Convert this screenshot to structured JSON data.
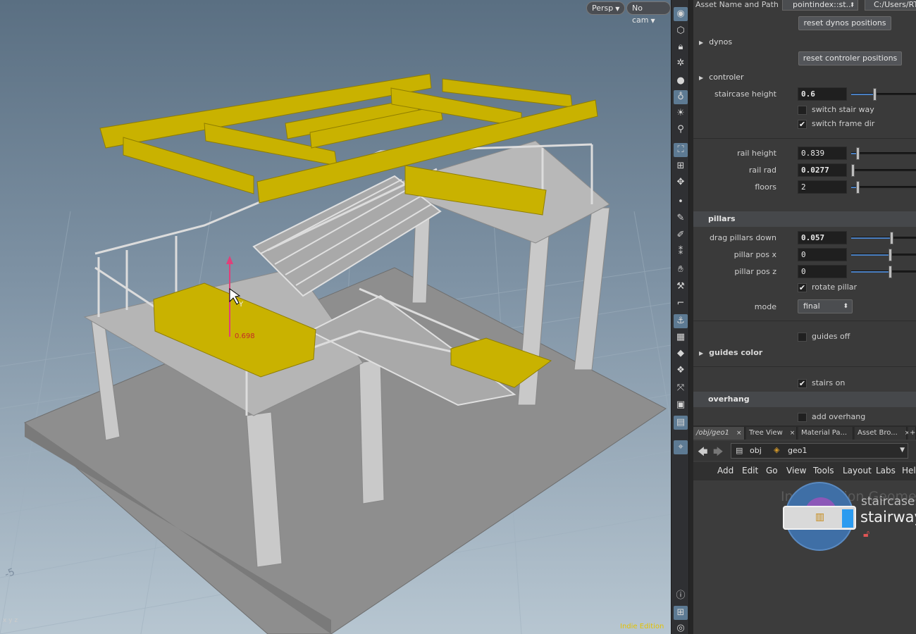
{
  "viewport": {
    "persp_label": "Persp",
    "cam_label": "No cam",
    "edition_label": "Indie Edition",
    "handle_value": "0.698",
    "handle_axis": "Y",
    "grid_number": "-5",
    "axis_label": "x y z"
  },
  "toolstrip": {
    "icons": [
      "camera-icon",
      "select-icon",
      "lock-icon",
      "sun-icon",
      "sphere-icon",
      "light-bulb-icon",
      "ambient-light-icon",
      "spot-light-icon",
      "snap-icon",
      "grid-icon",
      "handle-icon",
      "dot-icon",
      "pen-icon",
      "brush-icon",
      "number-icon",
      "hand-icon",
      "sculpt-icon",
      "curve-icon",
      "sim-icon",
      "checker-icon",
      "diamond-icon",
      "group-icon",
      "transform-icon",
      "display-icon",
      "frame-icon",
      "pin-icon",
      "info-icon",
      "layout-icon",
      "eye-icon"
    ]
  },
  "params": {
    "asset_label": "Asset Name and Path",
    "asset_name": "pointindex::st...",
    "asset_path": "C:/Users/RTX",
    "reset_dynos": "reset dynos positions",
    "dynos_folder": "dynos",
    "reset_controler": "reset controler positions",
    "controler_folder": "controler",
    "staircase_height": {
      "label": "staircase height",
      "value": "0.6",
      "fraction": 0.3
    },
    "switch_stair_way": {
      "label": "switch stair way",
      "checked": false
    },
    "switch_frame_dir": {
      "label": "switch frame dir",
      "checked": true
    },
    "rail_height": {
      "label": "rail height",
      "value": "0.839",
      "fraction": 0.08
    },
    "rail_rad": {
      "label": "rail rad",
      "value": "0.0277",
      "fraction": 0.0
    },
    "floors": {
      "label": "floors",
      "value": "2",
      "fraction": 0.08
    },
    "pillars_band": "pillars",
    "drag_pillars_down": {
      "label": "drag pillars down",
      "value": "0.057",
      "fraction": 0.52
    },
    "pillar_pos_x": {
      "label": "pillar pos x",
      "value": "0",
      "fraction": 0.5
    },
    "pillar_pos_z": {
      "label": "pillar pos z",
      "value": "0",
      "fraction": 0.5
    },
    "rotate_pillar": {
      "label": "rotate pillar",
      "checked": true
    },
    "mode": {
      "label": "mode",
      "value": "final"
    },
    "guides_off": {
      "label": "guides off",
      "checked": false
    },
    "guides_color_folder": "guides color",
    "stairs_on": {
      "label": "stairs on",
      "checked": true
    },
    "overhang_band": "overhang",
    "add_overhang": {
      "label": "add overhang",
      "checked": false
    }
  },
  "network": {
    "tabs": [
      {
        "label": "/obj/geo1",
        "active": true
      },
      {
        "label": "Tree View",
        "active": false
      },
      {
        "label": "Material Pa...",
        "active": false
      },
      {
        "label": "Asset Bro...",
        "active": false
      }
    ],
    "add_tab": "+",
    "path_obj": "obj",
    "path_geo": "geo1",
    "menu": [
      "Add",
      "Edit",
      "Go",
      "View",
      "Tools",
      "Layout",
      "Labs",
      "Help"
    ],
    "bg_text": "Indie Edition  Geome",
    "node_type": "staircase",
    "node_name": "stairway"
  },
  "colors": {
    "yellow": "#c9b200",
    "structure": "#c8c8c8",
    "platform": "#8f8f8f",
    "accent_blue": "#4a7fc1"
  }
}
